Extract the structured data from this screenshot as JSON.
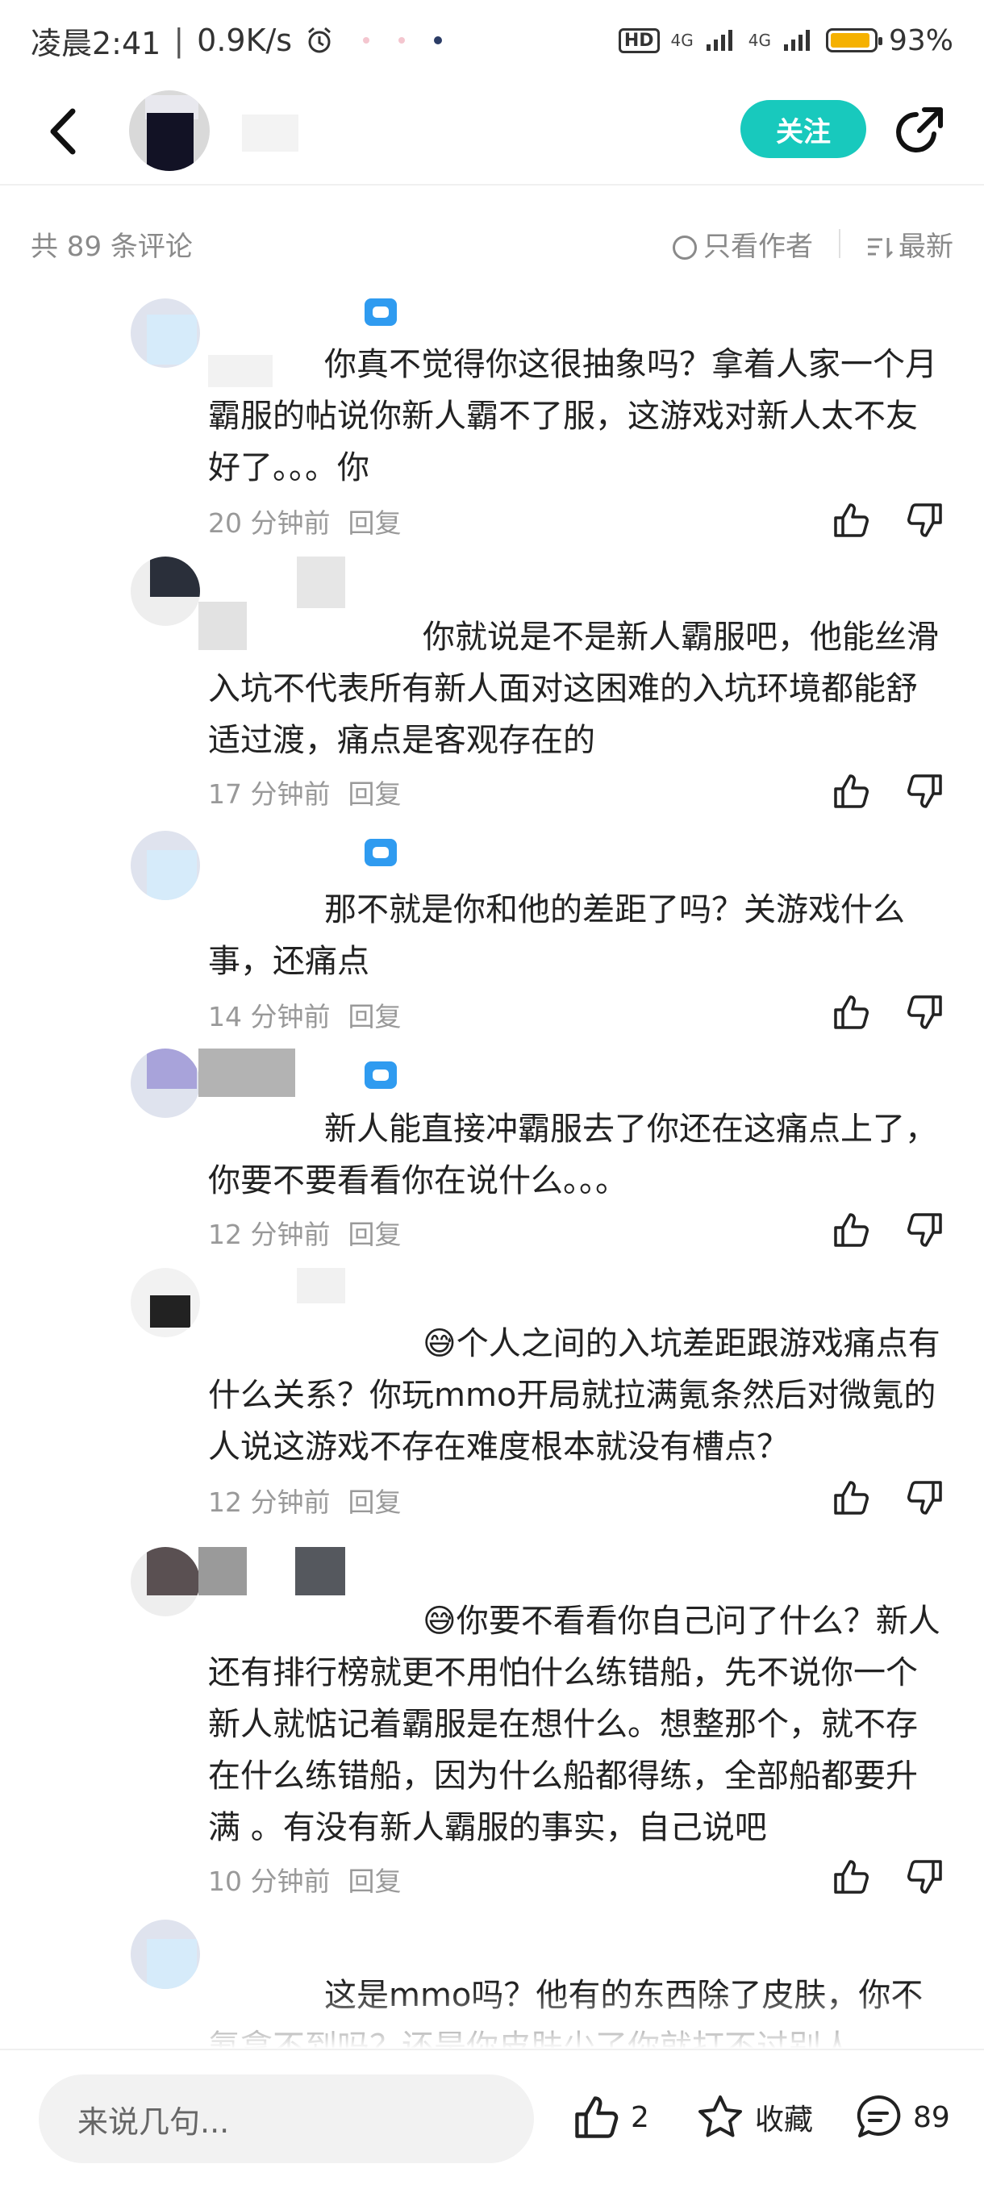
{
  "status_bar": {
    "time": "凌晨2:41",
    "speed": "0.9K/s",
    "signal1": "4G",
    "signal2": "4G",
    "hd_label": "HD",
    "battery": "93%",
    "battery_level": 0.93
  },
  "header": {
    "follow_label": "关注"
  },
  "filter_bar": {
    "count_text": "共 89 条评论",
    "author_only": "只看作者",
    "sort_label": "最新"
  },
  "comments": [
    {
      "text": "你真不觉得你这很抽象吗？拿着人家一个月霸服的帖说你新人霸不了服，这游戏对新人太不友好了。。。你",
      "time": "20 分钟前",
      "reply": "回复"
    },
    {
      "text": "你就说是不是新人霸服吧，他能丝滑入坑不代表所有新人面对这困难的入坑环境都能舒适过渡，痛点是客观存在的",
      "time": "17 分钟前",
      "reply": "回复"
    },
    {
      "text": "那不就是你和他的差距了吗？关游戏什么事，还痛点",
      "time": "14 分钟前",
      "reply": "回复"
    },
    {
      "text": "新人能直接冲霸服去了你还在这痛点上了，你要不要看看你在说什么。。。",
      "time": "12 分钟前",
      "reply": "回复"
    },
    {
      "text": "😅个人之间的入坑差距跟游戏痛点有什么关系？你玩mmo开局就拉满氪条然后对微氪的人说这游戏不存在难度根本就没有槽点？",
      "time": "12 分钟前",
      "reply": "回复"
    },
    {
      "text": "😅你要不看看你自己问了什么？新人还有排行榜就更不用怕什么练错船，先不说你一个新人就惦记着霸服是在想什么。想整那个，就不存在什么练错船，因为什么船都得练，全部船都要升满 。有没有新人霸服的事实，自己说吧",
      "time": "10 分钟前",
      "reply": "回复"
    },
    {
      "text": "这是mmo吗？他有的东西除了皮肤，你不氪拿不到吗？还是你皮肤少了你就打不过别人",
      "time": "",
      "reply": ""
    }
  ],
  "bottom_bar": {
    "input_placeholder": "来说几句...",
    "like_count": "2",
    "favorite_label": "收藏",
    "comment_count": "89"
  },
  "colors": {
    "accent": "#18c9bd",
    "badge": "#2f9bf0",
    "muted_text": "#999999",
    "battery": "#f5b100"
  }
}
